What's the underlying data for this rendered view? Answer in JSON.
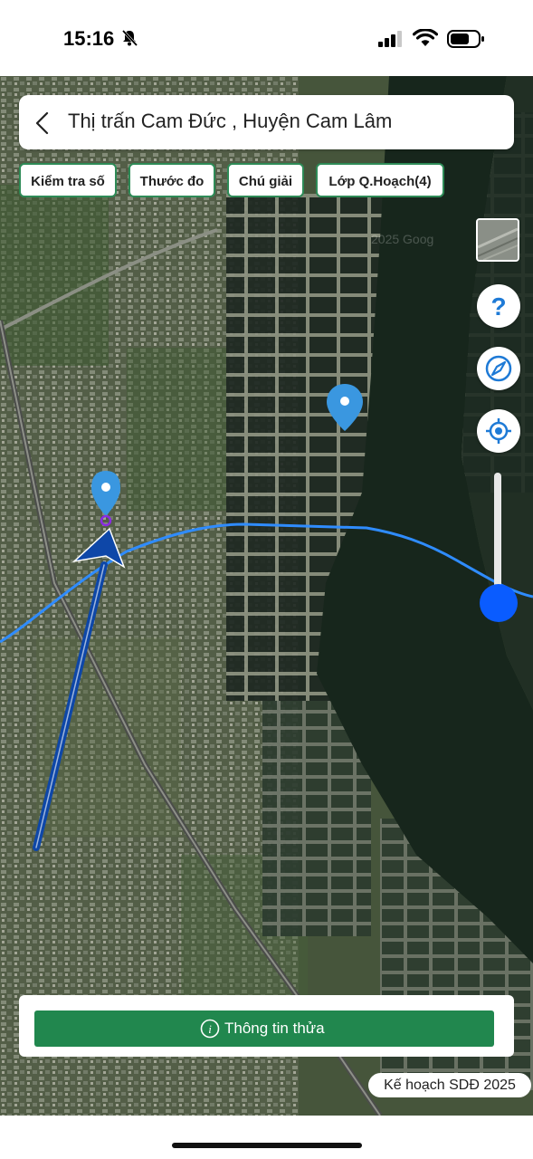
{
  "status_bar": {
    "time": "15:16"
  },
  "header": {
    "title": "Thị trấn Cam Đức , Huyện Cam Lâm"
  },
  "toolbar": {
    "chips": [
      "Kiểm tra số",
      "Thước đo",
      "Chú giải",
      "Lớp Q.Hoạch(4)"
    ]
  },
  "map": {
    "watermark": "2025 Goog",
    "layer_line_color": "#2f8cff",
    "pin_color": "#3a97e0",
    "arrow_color": "#0e47a8"
  },
  "controls": {
    "help_icon": "question-icon",
    "compass_icon": "compass-icon",
    "locate_icon": "locate-icon",
    "opacity_slider_level": 0.9
  },
  "bottom": {
    "info_button": "Thông tin thửa"
  },
  "plan_badge": "Kế hoạch SDĐ 2025"
}
